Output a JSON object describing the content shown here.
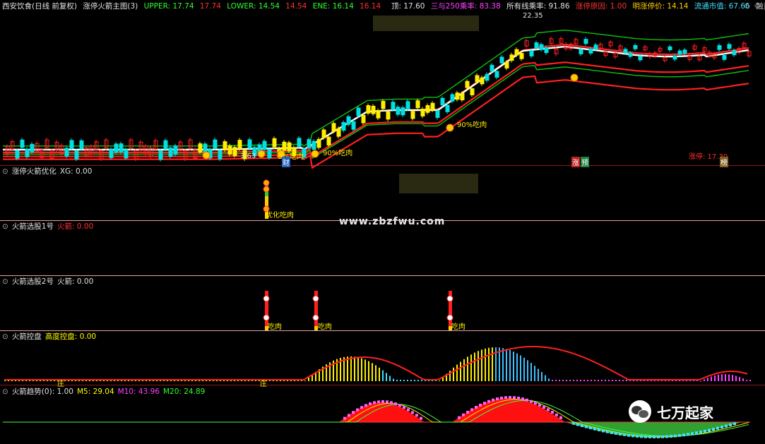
{
  "main_header": {
    "stock": "西安饮食(日线 前复权)",
    "indicator": "涨停火箭主图(3)",
    "upper_label": "UPPER:",
    "upper_val1": "17.74",
    "upper_val2": "17.74",
    "lower_label": "LOWER:",
    "lower_val1": "14.54",
    "lower_val2": "14.54",
    "ene_label": "ENE:",
    "ene_val1": "16.14",
    "ene_val2": "16.14",
    "right": [
      {
        "text": "顶: 17.60",
        "color": "#e0e0e0"
      },
      {
        "text": "三与250乘率: 83.38",
        "color": "#ff40ff"
      },
      {
        "text": "所有线乘率: 91.86",
        "color": "#e0e0e0"
      },
      {
        "text": "涨停原因: 1.00",
        "color": "#ff3030"
      },
      {
        "text": "明涨停价: 14.14",
        "color": "#ffcc00"
      },
      {
        "text": "流通市值: 67.66",
        "color": "#40e0ff"
      },
      {
        "text": "融资融券股: -",
        "color": "#c0c0c0"
      }
    ],
    "nav_icons": [
      "◇",
      "◇"
    ]
  },
  "main_annotations": {
    "peak": "22.35",
    "low": "3.63",
    "tag1": "9%吃肉",
    "tag2": "90%吃肉",
    "tag3": "90%吃肉",
    "cai": "财",
    "zhang": "涨",
    "yu": "预",
    "zt_label": "涨停: 17.30",
    "bang": "榜"
  },
  "panes": [
    {
      "title": "涨停火箭优化",
      "field": "XG: 0.00",
      "field_color": "#e0e0e0",
      "tag": "优化吃肉"
    },
    {
      "title": "火箭选股1号",
      "field": "火箭: 0.00",
      "field_color": "#ff3030"
    },
    {
      "title": "火箭选股2号",
      "field": "火箭: 0.00",
      "field_color": "#e0e0e0",
      "tag": "吃肉"
    },
    {
      "title": "火箭控盘",
      "field": "高度控盘: 0.00",
      "field_color": "#ffff00",
      "tag": "庄"
    },
    {
      "title": "火箭趋势(0)",
      "field": ": 1.00",
      "field_color": "#e0e0e0",
      "m5": "M5: 29.04",
      "m10": "M10: 43.96",
      "m20": "M20: 24.89"
    }
  ],
  "watermark": "www.zbzfwu.com",
  "wechat": "七万起家",
  "colors": {
    "up": "#ff2020",
    "down": "#00e0e0",
    "green": "#10c010",
    "yellow": "#ffee00",
    "white": "#ffffff"
  }
}
